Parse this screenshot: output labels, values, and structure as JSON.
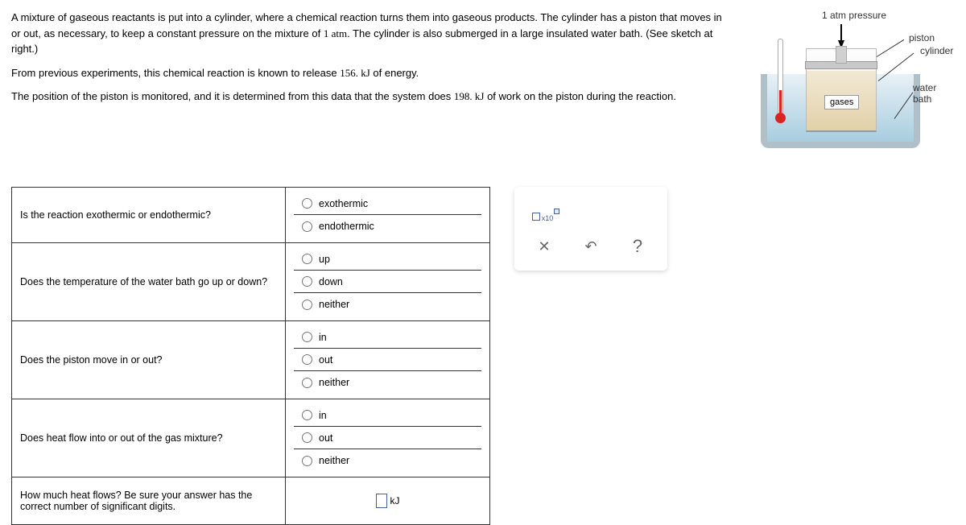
{
  "problem": {
    "p1_a": "A mixture of gaseous reactants is put into a cylinder, where a chemical reaction turns them into gaseous products. The cylinder has a piston that moves in or out, as necessary, to keep a constant pressure on the mixture of ",
    "p1_val": "1 atm",
    "p1_b": ". The cylinder is also submerged in a large insulated water bath. (See sketch at right.)",
    "p2_a": "From previous experiments, this chemical reaction is known to release ",
    "p2_val": "156. kJ",
    "p2_b": " of energy.",
    "p3_a": "The position of the piston is monitored, and it is determined from this data that the system does ",
    "p3_val": "198. kJ",
    "p3_b": " of work on the piston during the reaction."
  },
  "diagram": {
    "pressure_label": "1 atm pressure",
    "piston_label": "piston",
    "cylinder_label": "cylinder",
    "water_bath_label": "water bath",
    "gases_label": "gases"
  },
  "questions": {
    "q1": {
      "text": "Is the reaction exothermic or endothermic?",
      "opts": [
        "exothermic",
        "endothermic"
      ]
    },
    "q2": {
      "text": "Does the temperature of the water bath go up or down?",
      "opts": [
        "up",
        "down",
        "neither"
      ]
    },
    "q3": {
      "text": "Does the piston move in or out?",
      "opts": [
        "in",
        "out",
        "neither"
      ]
    },
    "q4": {
      "text": "Does heat flow into or out of the gas mixture?",
      "opts": [
        "in",
        "out",
        "neither"
      ]
    },
    "q5": {
      "text": "How much heat flows? Be sure your answer has the correct number of significant digits.",
      "unit": "kJ"
    }
  },
  "toolbar": {
    "x10": "x10",
    "clear": "✕",
    "undo": "↶",
    "help": "?"
  }
}
